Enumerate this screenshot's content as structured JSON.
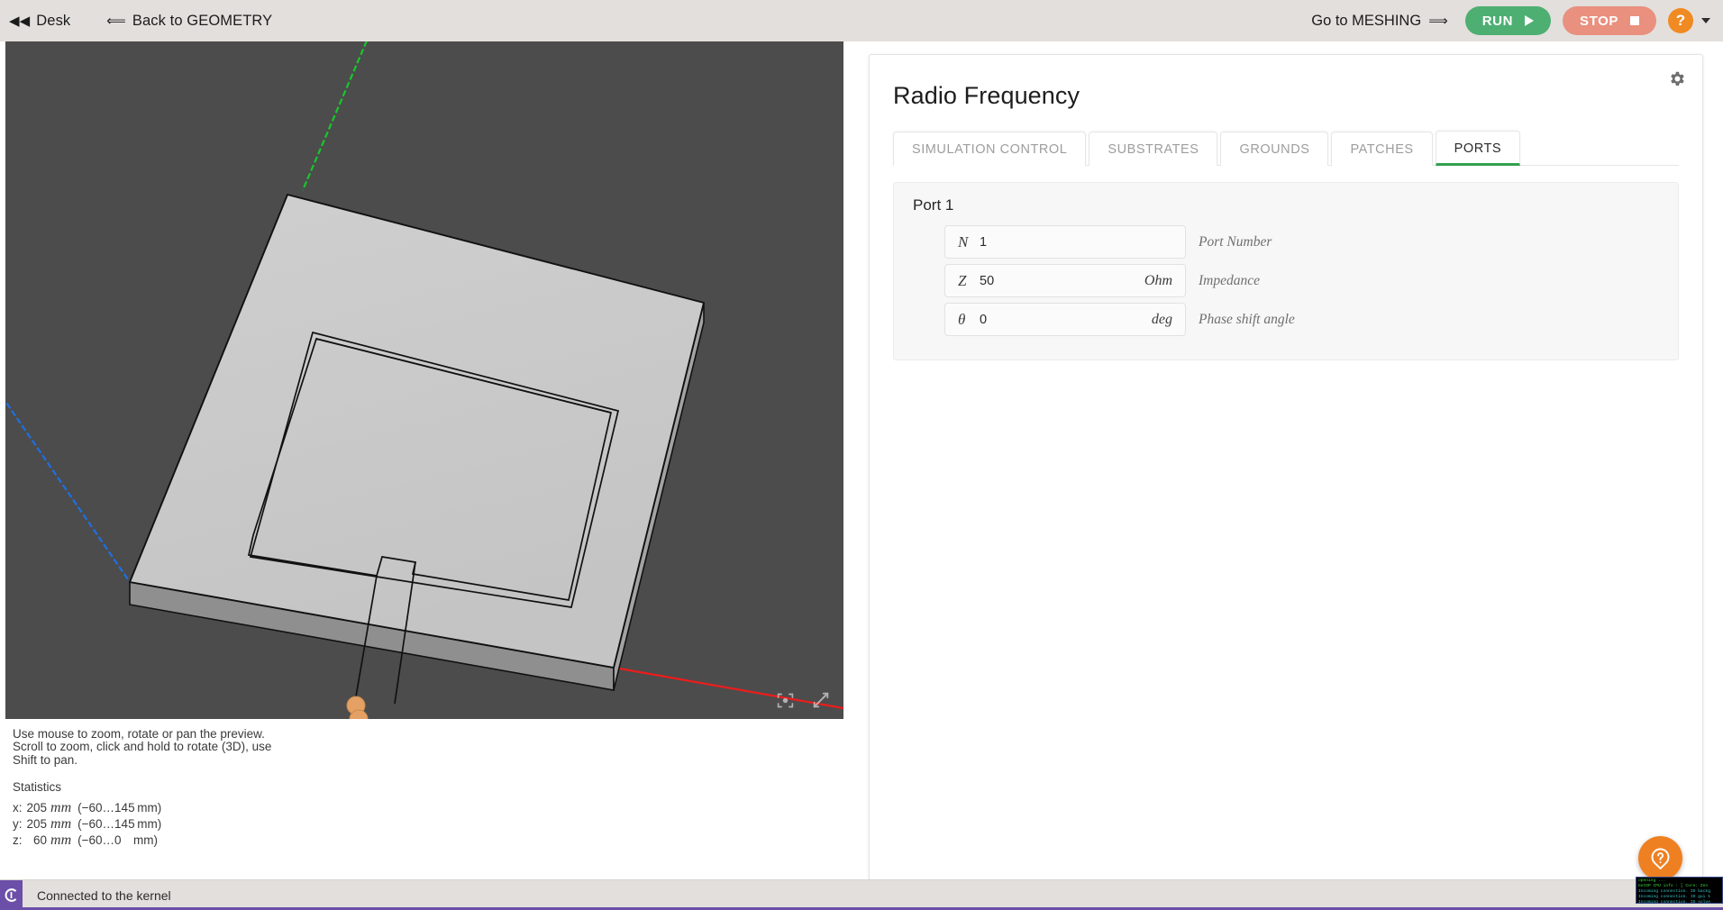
{
  "topbar": {
    "desk_label": "Desk",
    "desk_icon": "double-left-arrow-icon",
    "back_label": "Back to GEOMETRY",
    "back_icon": "left-arrow-icon",
    "goto_label": "Go to MESHING",
    "goto_icon": "right-arrow-icon",
    "run_label": "RUN",
    "run_icon": "play-triangle-icon",
    "run_color": "#4eaf72",
    "stop_label": "STOP",
    "stop_icon": "stop-square-icon",
    "stop_color": "#e9907f",
    "help_label": "?",
    "help_color": "#f08a22",
    "help_caret_icon": "chevron-down-icon"
  },
  "viewport": {
    "background_color": "#4c4c4c",
    "axes": [
      {
        "name": "x-axis",
        "color": "#ee1c1c"
      },
      {
        "name": "y-axis",
        "color": "#1f6fe0"
      },
      {
        "name": "z-axis",
        "color": "#17c72b"
      }
    ],
    "geometry_name": "inset-fed-patch-antenna",
    "substrate_color": "#c9c9c9",
    "port_marker_color": "#e8a768",
    "tools": [
      {
        "name": "center-view-icon",
        "label": "Center view"
      },
      {
        "name": "fullscreen-icon",
        "label": "Fullscreen"
      }
    ]
  },
  "hints": {
    "line1": "Use mouse to zoom, rotate or pan the preview.",
    "line2": "Scroll to zoom, click and hold to rotate (3D), use",
    "line3": "Shift to pan."
  },
  "statistics": {
    "title": "Statistics",
    "rows": [
      {
        "axis": "x:",
        "size": "205",
        "unit": "mm",
        "range": "(−60…145 mm)"
      },
      {
        "axis": "y:",
        "size": "205",
        "unit": "mm",
        "range": "(−60…145 mm)"
      },
      {
        "axis": "z:",
        "size": "60",
        "unit": "mm",
        "range": "(−60…0 mm)"
      }
    ]
  },
  "panel": {
    "title": "Radio Frequency",
    "gear_icon": "gear-icon",
    "tabs": [
      {
        "label": "SIMULATION CONTROL",
        "active": false
      },
      {
        "label": "SUBSTRATES",
        "active": false
      },
      {
        "label": "GROUNDS",
        "active": false
      },
      {
        "label": "PATCHES",
        "active": false
      },
      {
        "label": "PORTS",
        "active": true
      }
    ],
    "active_tab_color": "#31a04f",
    "port": {
      "group_title": "Port 1",
      "fields": [
        {
          "symbol": "N",
          "value": "1",
          "unit": "",
          "description": "Port Number"
        },
        {
          "symbol": "Z",
          "value": "50",
          "unit": "Ohm",
          "description": "Impedance"
        },
        {
          "symbol": "θ",
          "value": "0",
          "unit": "deg",
          "description": "Phase shift angle"
        }
      ]
    },
    "fab": {
      "icon": "help-bubble-icon",
      "color": "#ef8021"
    }
  },
  "statusbar": {
    "logo_icon": "kernel-logo-icon",
    "logo_color": "#6b4fa8",
    "message": "Connected to the kernel",
    "terminal_lines": [
      "opening ...",
      "GetDP CPU info : [ Core: Zen",
      "Incoming connection. ID backg",
      "Incoming connection. ID gui 1",
      "Incoming connection. ID solve"
    ]
  }
}
